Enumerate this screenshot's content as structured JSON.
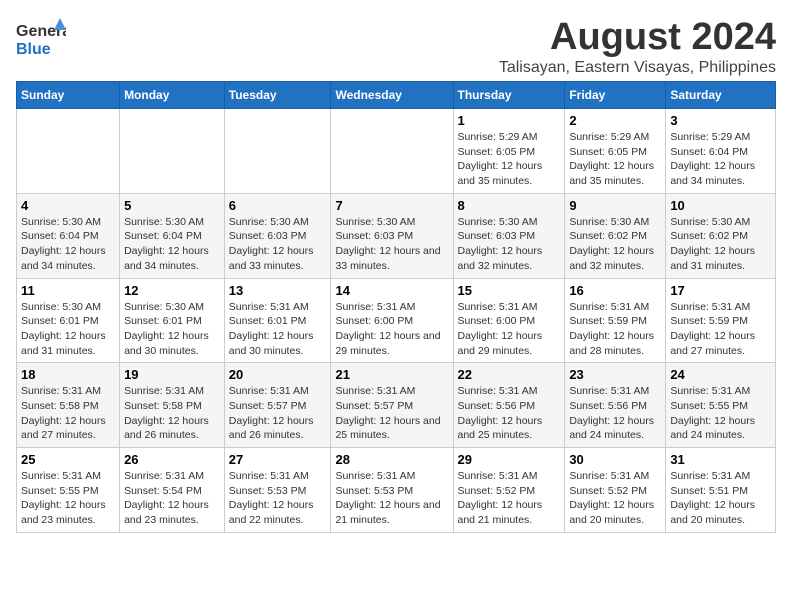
{
  "header": {
    "logo_text_general": "General",
    "logo_text_blue": "Blue",
    "title": "August 2024",
    "subtitle": "Talisayan, Eastern Visayas, Philippines"
  },
  "days_of_week": [
    "Sunday",
    "Monday",
    "Tuesday",
    "Wednesday",
    "Thursday",
    "Friday",
    "Saturday"
  ],
  "weeks": [
    [
      {
        "day": "",
        "info": ""
      },
      {
        "day": "",
        "info": ""
      },
      {
        "day": "",
        "info": ""
      },
      {
        "day": "",
        "info": ""
      },
      {
        "day": "1",
        "info": "Sunrise: 5:29 AM\nSunset: 6:05 PM\nDaylight: 12 hours and 35 minutes."
      },
      {
        "day": "2",
        "info": "Sunrise: 5:29 AM\nSunset: 6:05 PM\nDaylight: 12 hours and 35 minutes."
      },
      {
        "day": "3",
        "info": "Sunrise: 5:29 AM\nSunset: 6:04 PM\nDaylight: 12 hours and 34 minutes."
      }
    ],
    [
      {
        "day": "4",
        "info": "Sunrise: 5:30 AM\nSunset: 6:04 PM\nDaylight: 12 hours and 34 minutes."
      },
      {
        "day": "5",
        "info": "Sunrise: 5:30 AM\nSunset: 6:04 PM\nDaylight: 12 hours and 34 minutes."
      },
      {
        "day": "6",
        "info": "Sunrise: 5:30 AM\nSunset: 6:03 PM\nDaylight: 12 hours and 33 minutes."
      },
      {
        "day": "7",
        "info": "Sunrise: 5:30 AM\nSunset: 6:03 PM\nDaylight: 12 hours and 33 minutes."
      },
      {
        "day": "8",
        "info": "Sunrise: 5:30 AM\nSunset: 6:03 PM\nDaylight: 12 hours and 32 minutes."
      },
      {
        "day": "9",
        "info": "Sunrise: 5:30 AM\nSunset: 6:02 PM\nDaylight: 12 hours and 32 minutes."
      },
      {
        "day": "10",
        "info": "Sunrise: 5:30 AM\nSunset: 6:02 PM\nDaylight: 12 hours and 31 minutes."
      }
    ],
    [
      {
        "day": "11",
        "info": "Sunrise: 5:30 AM\nSunset: 6:01 PM\nDaylight: 12 hours and 31 minutes."
      },
      {
        "day": "12",
        "info": "Sunrise: 5:30 AM\nSunset: 6:01 PM\nDaylight: 12 hours and 30 minutes."
      },
      {
        "day": "13",
        "info": "Sunrise: 5:31 AM\nSunset: 6:01 PM\nDaylight: 12 hours and 30 minutes."
      },
      {
        "day": "14",
        "info": "Sunrise: 5:31 AM\nSunset: 6:00 PM\nDaylight: 12 hours and 29 minutes."
      },
      {
        "day": "15",
        "info": "Sunrise: 5:31 AM\nSunset: 6:00 PM\nDaylight: 12 hours and 29 minutes."
      },
      {
        "day": "16",
        "info": "Sunrise: 5:31 AM\nSunset: 5:59 PM\nDaylight: 12 hours and 28 minutes."
      },
      {
        "day": "17",
        "info": "Sunrise: 5:31 AM\nSunset: 5:59 PM\nDaylight: 12 hours and 27 minutes."
      }
    ],
    [
      {
        "day": "18",
        "info": "Sunrise: 5:31 AM\nSunset: 5:58 PM\nDaylight: 12 hours and 27 minutes."
      },
      {
        "day": "19",
        "info": "Sunrise: 5:31 AM\nSunset: 5:58 PM\nDaylight: 12 hours and 26 minutes."
      },
      {
        "day": "20",
        "info": "Sunrise: 5:31 AM\nSunset: 5:57 PM\nDaylight: 12 hours and 26 minutes."
      },
      {
        "day": "21",
        "info": "Sunrise: 5:31 AM\nSunset: 5:57 PM\nDaylight: 12 hours and 25 minutes."
      },
      {
        "day": "22",
        "info": "Sunrise: 5:31 AM\nSunset: 5:56 PM\nDaylight: 12 hours and 25 minutes."
      },
      {
        "day": "23",
        "info": "Sunrise: 5:31 AM\nSunset: 5:56 PM\nDaylight: 12 hours and 24 minutes."
      },
      {
        "day": "24",
        "info": "Sunrise: 5:31 AM\nSunset: 5:55 PM\nDaylight: 12 hours and 24 minutes."
      }
    ],
    [
      {
        "day": "25",
        "info": "Sunrise: 5:31 AM\nSunset: 5:55 PM\nDaylight: 12 hours and 23 minutes."
      },
      {
        "day": "26",
        "info": "Sunrise: 5:31 AM\nSunset: 5:54 PM\nDaylight: 12 hours and 23 minutes."
      },
      {
        "day": "27",
        "info": "Sunrise: 5:31 AM\nSunset: 5:53 PM\nDaylight: 12 hours and 22 minutes."
      },
      {
        "day": "28",
        "info": "Sunrise: 5:31 AM\nSunset: 5:53 PM\nDaylight: 12 hours and 21 minutes."
      },
      {
        "day": "29",
        "info": "Sunrise: 5:31 AM\nSunset: 5:52 PM\nDaylight: 12 hours and 21 minutes."
      },
      {
        "day": "30",
        "info": "Sunrise: 5:31 AM\nSunset: 5:52 PM\nDaylight: 12 hours and 20 minutes."
      },
      {
        "day": "31",
        "info": "Sunrise: 5:31 AM\nSunset: 5:51 PM\nDaylight: 12 hours and 20 minutes."
      }
    ]
  ]
}
